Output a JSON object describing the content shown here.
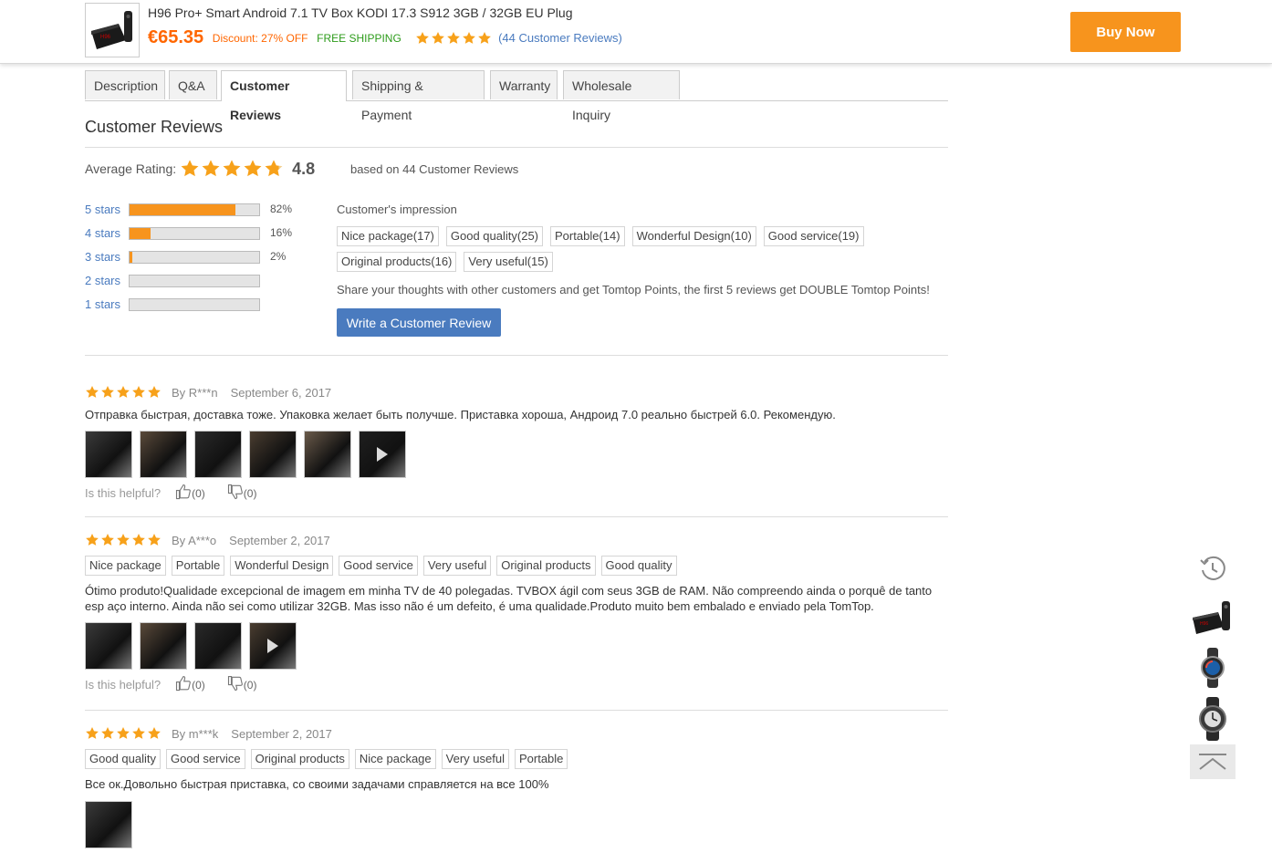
{
  "header": {
    "product_title": "H96 Pro+ Smart Android 7.1 TV Box KODI 17.3 S912 3GB / 32GB EU Plug",
    "price": "€65.35",
    "discount": "Discount: 27% OFF",
    "shipping": "FREE SHIPPING",
    "review_link": "(44 Customer Reviews)",
    "buy_label": "Buy Now",
    "rating_stars": 5
  },
  "tabs": [
    {
      "label": "Description"
    },
    {
      "label": "Q&A"
    },
    {
      "label": "Customer Reviews",
      "active": true
    },
    {
      "label": "Shipping & Payment"
    },
    {
      "label": "Warranty"
    },
    {
      "label": "Wholesale Inquiry"
    }
  ],
  "reviews_section": {
    "title": "Customer Reviews",
    "average_label": "Average Rating:",
    "average_value": "4.8",
    "average_stars": 4.8,
    "based_on": "based on 44 Customer Reviews",
    "distribution": [
      {
        "label": "5 stars",
        "pct_text": "82%",
        "pct": 82
      },
      {
        "label": "4 stars",
        "pct_text": "16%",
        "pct": 16
      },
      {
        "label": "3 stars",
        "pct_text": "2%",
        "pct": 2
      },
      {
        "label": "2 stars",
        "pct_text": "",
        "pct": 0
      },
      {
        "label": "1 stars",
        "pct_text": "",
        "pct": 0
      }
    ],
    "impression_title": "Customer's impression",
    "impressions": [
      "Nice package(17)",
      "Good quality(25)",
      "Portable(14)",
      "Wonderful Design(10)",
      "Good service(19)",
      "Original products(16)",
      "Very useful(15)"
    ],
    "share_text": "Share your thoughts with other customers and get Tomtop Points, the first 5 reviews get DOUBLE Tomtop Points!",
    "write_label": "Write a Customer Review"
  },
  "reviews": [
    {
      "stars": 5,
      "author": "By R***n",
      "date": "September 6, 2017",
      "tags": [],
      "text": "Отправка быстрая, доставка тоже. Упаковка желает быть получше. Приставка хороша, Андроид 7.0 реально быстрей 6.0. Рекомендую.",
      "photos": [
        "photo",
        "photo",
        "photo",
        "photo",
        "photo",
        "video"
      ],
      "helpful_label": "Is this helpful?",
      "up": "(0)",
      "down": "(0)"
    },
    {
      "stars": 5,
      "author": "By A***o",
      "date": "September 2, 2017",
      "tags": [
        "Nice package",
        "Portable",
        "Wonderful Design",
        "Good service",
        "Very useful",
        "Original products",
        "Good quality"
      ],
      "text": "Ótimo produto!Qualidade excepcional de imagem em minha TV de 40 polegadas. TVBOX ágil com seus 3GB de RAM. Não compreendo ainda o porquê de tanto esp aço interno. Ainda não sei como utilizar 32GB. Mas isso não é um defeito, é uma qualidade.Produto muito bem embalado e enviado pela TomTop.",
      "photos": [
        "photo",
        "photo",
        "photo",
        "video"
      ],
      "helpful_label": "Is this helpful?",
      "up": "(0)",
      "down": "(0)"
    },
    {
      "stars": 5,
      "author": "By m***k",
      "date": "September 2, 2017",
      "tags": [
        "Good quality",
        "Good service",
        "Original products",
        "Nice package",
        "Very useful",
        "Portable"
      ],
      "text": "Все ок.Довольно быстрая приставка, со своими задачами справляется на все 100%",
      "photos": [
        "photo"
      ],
      "helpful_label": "",
      "up": "",
      "down": ""
    }
  ],
  "sidebar": {
    "items": [
      "history-icon",
      "product-thumb-tvbox",
      "product-thumb-watch-1",
      "product-thumb-watch-2",
      "back-to-top-icon"
    ]
  },
  "colors": {
    "accent": "#f7941d",
    "price": "#ff6600",
    "link": "#4a7bbf",
    "free_shipping": "#2c9b1a"
  }
}
